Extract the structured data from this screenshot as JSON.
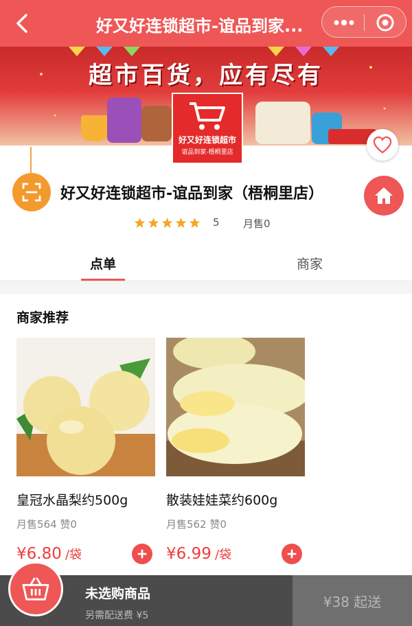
{
  "header": {
    "title": "好又好连锁超市-谊品到家..."
  },
  "banner": {
    "slogan": "超市百货，应有尽有"
  },
  "shop": {
    "logo_line1": "好又好连锁超市",
    "logo_line2": "谊品到家-梧桐里店",
    "name": "好又好连锁超市-谊品到家（梧桐里店）",
    "rating": "5",
    "monthly_sales": "月售0",
    "star_count": 5
  },
  "tabs": [
    {
      "label": "点单",
      "active": true
    },
    {
      "label": "商家",
      "active": false
    }
  ],
  "recommend": {
    "title": "商家推荐",
    "items": [
      {
        "name": "皇冠水晶梨约500g",
        "stats": "月售564 赞0",
        "price": "¥6.80",
        "unit": "/袋",
        "image": "pear-photo"
      },
      {
        "name": "散装娃娃菜约600g",
        "stats": "月售562 赞0",
        "price": "¥6.99",
        "unit": "/袋",
        "image": "cabbage-photo"
      }
    ]
  },
  "cart": {
    "title": "未选购商品",
    "delivery_fee": "另需配送费 ¥5",
    "min_order": "¥38 起送"
  },
  "colors": {
    "brand_red": "#ef5656",
    "price_red": "#ef3d3d",
    "star_orange": "#f5a623",
    "scan_orange": "#f39a2f"
  }
}
